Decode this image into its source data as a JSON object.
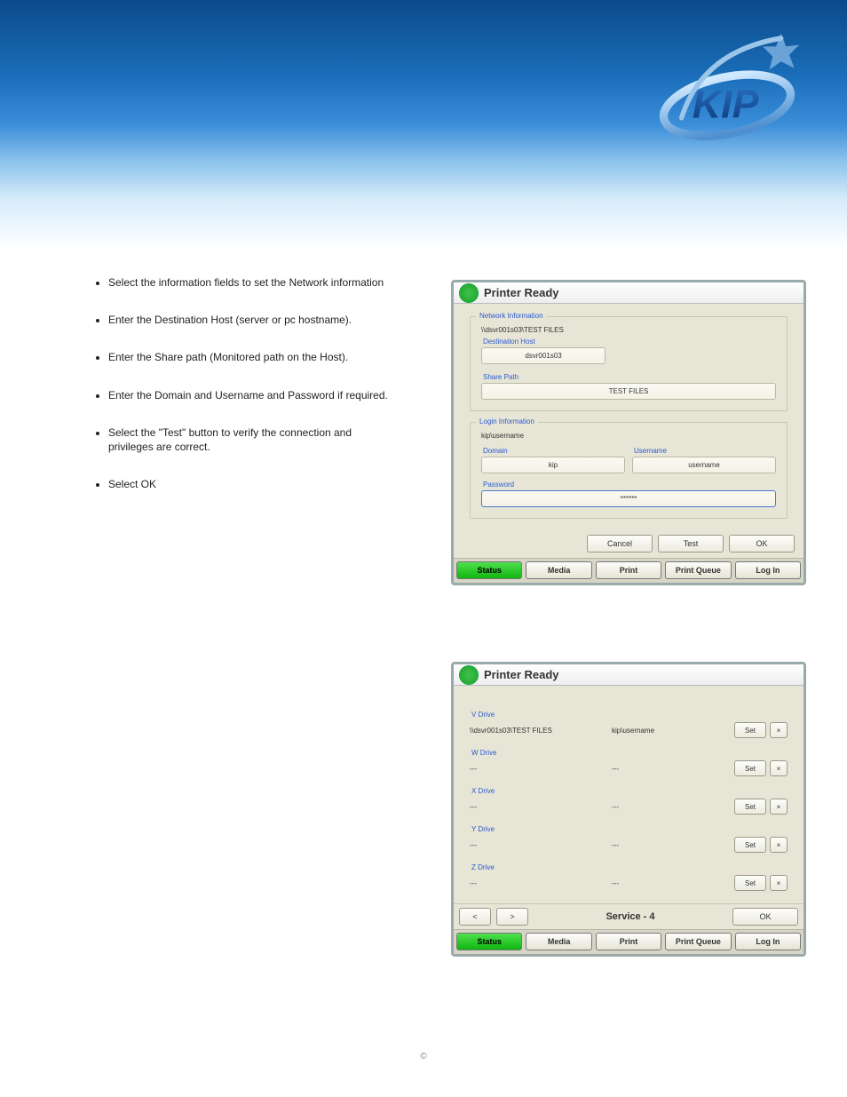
{
  "header": {
    "logo_text": "KIP"
  },
  "bullets": [
    "Select the information fields to set the Network information",
    "Enter the Destination Host (server or pc hostname).",
    "Enter the Share path (Monitored path on the Host).",
    "Enter the Domain and Username and Password if required.",
    "Select the \"Test\" button to verify the connection and privileges are correct.",
    "Select OK"
  ],
  "panel1": {
    "title": "Printer Ready",
    "network_legend": "Network Information",
    "network_summary": "\\\\dsvr001s03\\TEST FILES",
    "dest_label": "Destination Host",
    "dest_value": "dsvr001s03",
    "share_label": "Share Path",
    "share_value": "TEST FILES",
    "login_legend": "Login Information",
    "login_summary": "kip\\username",
    "domain_label": "Domain",
    "domain_value": "kip",
    "user_label": "Username",
    "user_value": "username",
    "pass_label": "Password",
    "pass_value": "******",
    "cancel": "Cancel",
    "test": "Test",
    "ok": "OK",
    "tabs": [
      "Status",
      "Media",
      "Print",
      "Print Queue",
      "Log In"
    ]
  },
  "panel2": {
    "title": "Printer Ready",
    "drives": [
      {
        "label": "V Drive",
        "path": "\\\\dsvr001s03\\TEST FILES",
        "user": "kip\\username"
      },
      {
        "label": "W Drive",
        "path": "---",
        "user": "---"
      },
      {
        "label": "X Drive",
        "path": "---",
        "user": "---"
      },
      {
        "label": "Y Drive",
        "path": "---",
        "user": "---"
      },
      {
        "label": "Z Drive",
        "path": "---",
        "user": "---"
      }
    ],
    "set": "Set",
    "x": "×",
    "prev": "<",
    "next": ">",
    "service": "Service - 4",
    "ok": "OK",
    "tabs": [
      "Status",
      "Media",
      "Print",
      "Print Queue",
      "Log In"
    ]
  },
  "footer": "©"
}
